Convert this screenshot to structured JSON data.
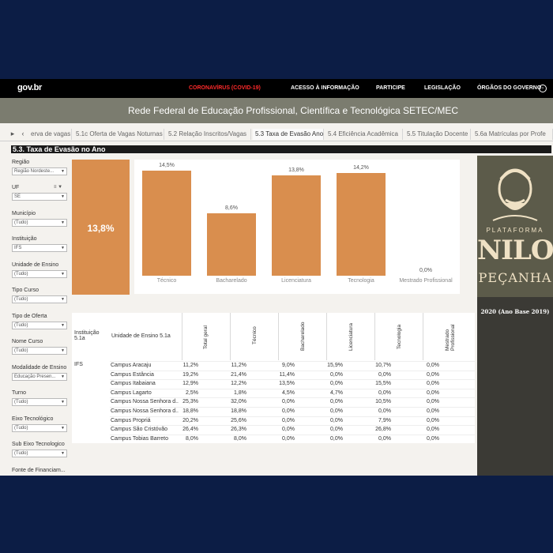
{
  "govbar": {
    "logo": "gov.br",
    "links": [
      "CORONAVÍRUS (COVID-19)",
      "ACESSO À INFORMAÇÃO",
      "PARTICIPE",
      "LEGISLAÇÃO",
      "ÓRGÃOS DO GOVERNO"
    ]
  },
  "title": "Rede Federal de Educação Profissional, Científica e Tecnológica SETEC/MEC",
  "tabs": [
    "erva de vagas",
    "5.1c Oferta de Vagas Noturnas",
    "5.2 Relação Inscritos/Vagas",
    "5.3 Taxa de Evasão Ano",
    "5.4 Eficiência Acadêmica",
    "5.5 Titulação Docente",
    "5.6a Matrículas por Profe"
  ],
  "section_title": "5.3. Taxa de Evasão no Ano",
  "filters": [
    {
      "label": "Região",
      "value": "Região Nordeste..."
    },
    {
      "label": "UF",
      "value": "SE"
    },
    {
      "label": "Município",
      "value": "(Tudo)"
    },
    {
      "label": "Instituição",
      "value": "IFS"
    },
    {
      "label": "Unidade de Ensino",
      "value": "(Tudo)"
    },
    {
      "label": "Tipo Curso",
      "value": "(Tudo)"
    },
    {
      "label": "Tipo de Oferta",
      "value": "(Tudo)"
    },
    {
      "label": "Nome Curso",
      "value": "(Tudo)"
    },
    {
      "label": "Modalidade de Ensino",
      "value": "Educação Presen..."
    },
    {
      "label": "Turno",
      "value": "(Tudo)"
    },
    {
      "label": "Eixo Tecnológico",
      "value": "(Tudo)"
    },
    {
      "label": "Sub Eixo Tecnologico",
      "value": "(Tudo)"
    },
    {
      "label": "Fonte de Financiam...",
      "value": ""
    }
  ],
  "kpi": "13,8%",
  "chart_data": {
    "type": "bar",
    "categories": [
      "Técnico",
      "Bacharelado",
      "Licenciatura",
      "Tecnologia",
      "Mestrado Profissional"
    ],
    "values": [
      14.5,
      8.6,
      13.8,
      14.2,
      0.0
    ],
    "value_labels": [
      "14,5%",
      "8,6%",
      "13,8%",
      "14,2%",
      "0,0%"
    ],
    "ylim": [
      0,
      14.5
    ],
    "color": "#d98e4e"
  },
  "table": {
    "headers": {
      "inst": "Instituição 5.1a",
      "unit": "Unidade de Ensino 5.1a"
    },
    "vheaders": [
      "Total geral",
      "Técnico",
      "Bacharelado",
      "Licenciatura",
      "Tecnologia",
      "Mestrado Profissional"
    ],
    "institution": "IFS",
    "rows": [
      {
        "name": "Campus Aracaju",
        "vals": [
          "11,2%",
          "11,2%",
          "9,0%",
          "15,9%",
          "10,7%",
          "0,0%"
        ]
      },
      {
        "name": "Campus Estância",
        "vals": [
          "19,2%",
          "21,4%",
          "11,4%",
          "0,0%",
          "0,0%",
          "0,0%"
        ]
      },
      {
        "name": "Campus Itabaiana",
        "vals": [
          "12,9%",
          "12,2%",
          "13,5%",
          "0,0%",
          "15,5%",
          "0,0%"
        ]
      },
      {
        "name": "Campus Lagarto",
        "vals": [
          "2,5%",
          "1,8%",
          "4,5%",
          "4,7%",
          "0,0%",
          "0,0%"
        ]
      },
      {
        "name": "Campus Nossa Senhora d..",
        "vals": [
          "25,3%",
          "32,0%",
          "0,0%",
          "0,0%",
          "10,5%",
          "0,0%"
        ]
      },
      {
        "name": "Campus Nossa Senhora d..",
        "vals": [
          "18,8%",
          "18,8%",
          "0,0%",
          "0,0%",
          "0,0%",
          "0,0%"
        ]
      },
      {
        "name": "Campus Propriá",
        "vals": [
          "20,2%",
          "25,6%",
          "0,0%",
          "0,0%",
          "7,9%",
          "0,0%"
        ]
      },
      {
        "name": "Campus São Cristóvão",
        "vals": [
          "26,4%",
          "26,3%",
          "0,0%",
          "0,0%",
          "26,8%",
          "0,0%"
        ]
      },
      {
        "name": "Campus Tobias Barreto",
        "vals": [
          "8,0%",
          "8,0%",
          "0,0%",
          "0,0%",
          "0,0%",
          "0,0%"
        ]
      }
    ]
  },
  "panel": {
    "brand_top": "PLATAFORMA",
    "brand_main": "NILO",
    "brand_sub": "PEÇANHA",
    "year": "2020 (Ano Base 2019)"
  }
}
